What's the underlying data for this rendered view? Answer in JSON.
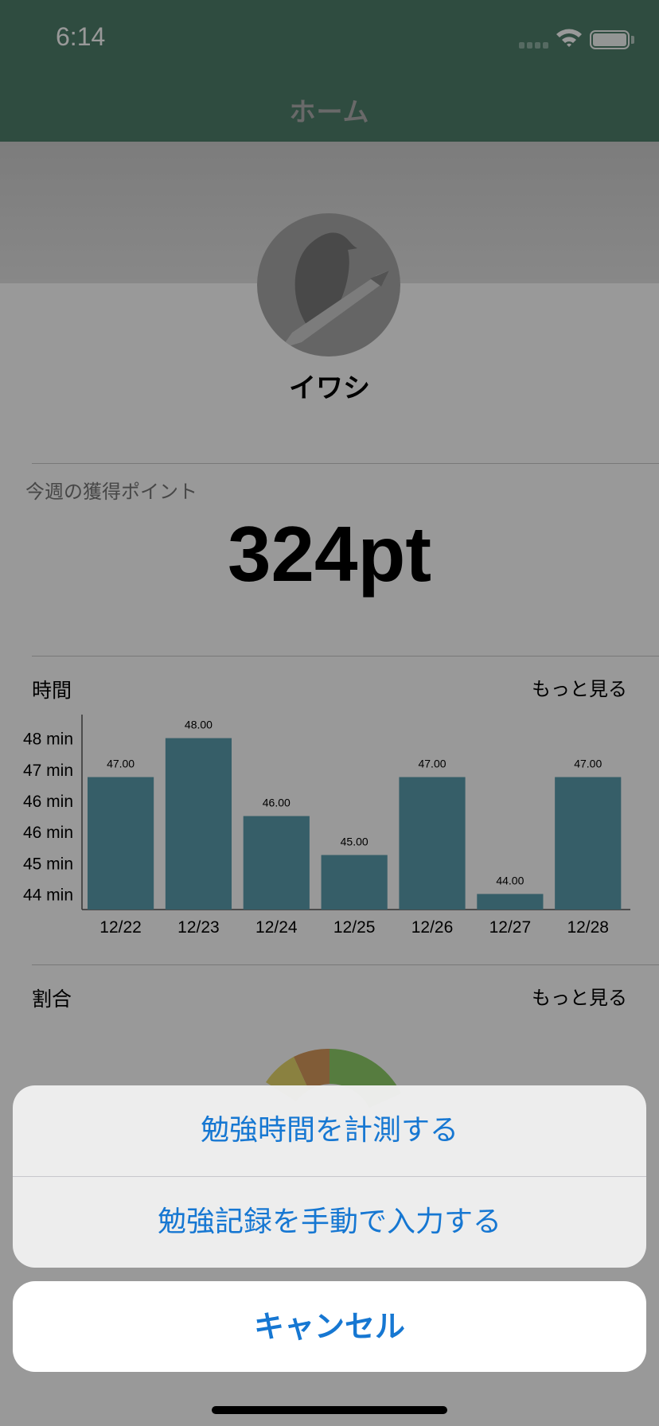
{
  "status": {
    "time": "6:14"
  },
  "nav": {
    "title": "ホーム"
  },
  "profile": {
    "name": "イワシ"
  },
  "points": {
    "label": "今週の獲得ポイント",
    "value": "324pt"
  },
  "time_section": {
    "title": "時間",
    "more": "もっと見る"
  },
  "ratio_section": {
    "title": "割合",
    "more": "もっと見る"
  },
  "chart_data": {
    "type": "bar",
    "categories": [
      "12/22",
      "12/23",
      "12/24",
      "12/25",
      "12/26",
      "12/27",
      "12/28"
    ],
    "values": [
      47.0,
      48.0,
      46.0,
      45.0,
      47.0,
      44.0,
      47.0
    ],
    "value_labels": [
      "47.00",
      "48.00",
      "46.00",
      "45.00",
      "47.00",
      "44.00",
      "47.00"
    ],
    "y_tick_labels": [
      "48 min",
      "47 min",
      "46 min",
      "46 min",
      "45 min",
      "44 min"
    ],
    "y_ticks": [
      48,
      47.2,
      46.4,
      45.6,
      44.8,
      44
    ],
    "ylim": [
      43.6,
      48.4
    ],
    "bar_color": "#5b9dae"
  },
  "action_sheet": {
    "actions": [
      "勉強時間を計測する",
      "勉強記録を手動で入力する"
    ],
    "cancel": "キャンセル",
    "tint": "#1677d2"
  }
}
